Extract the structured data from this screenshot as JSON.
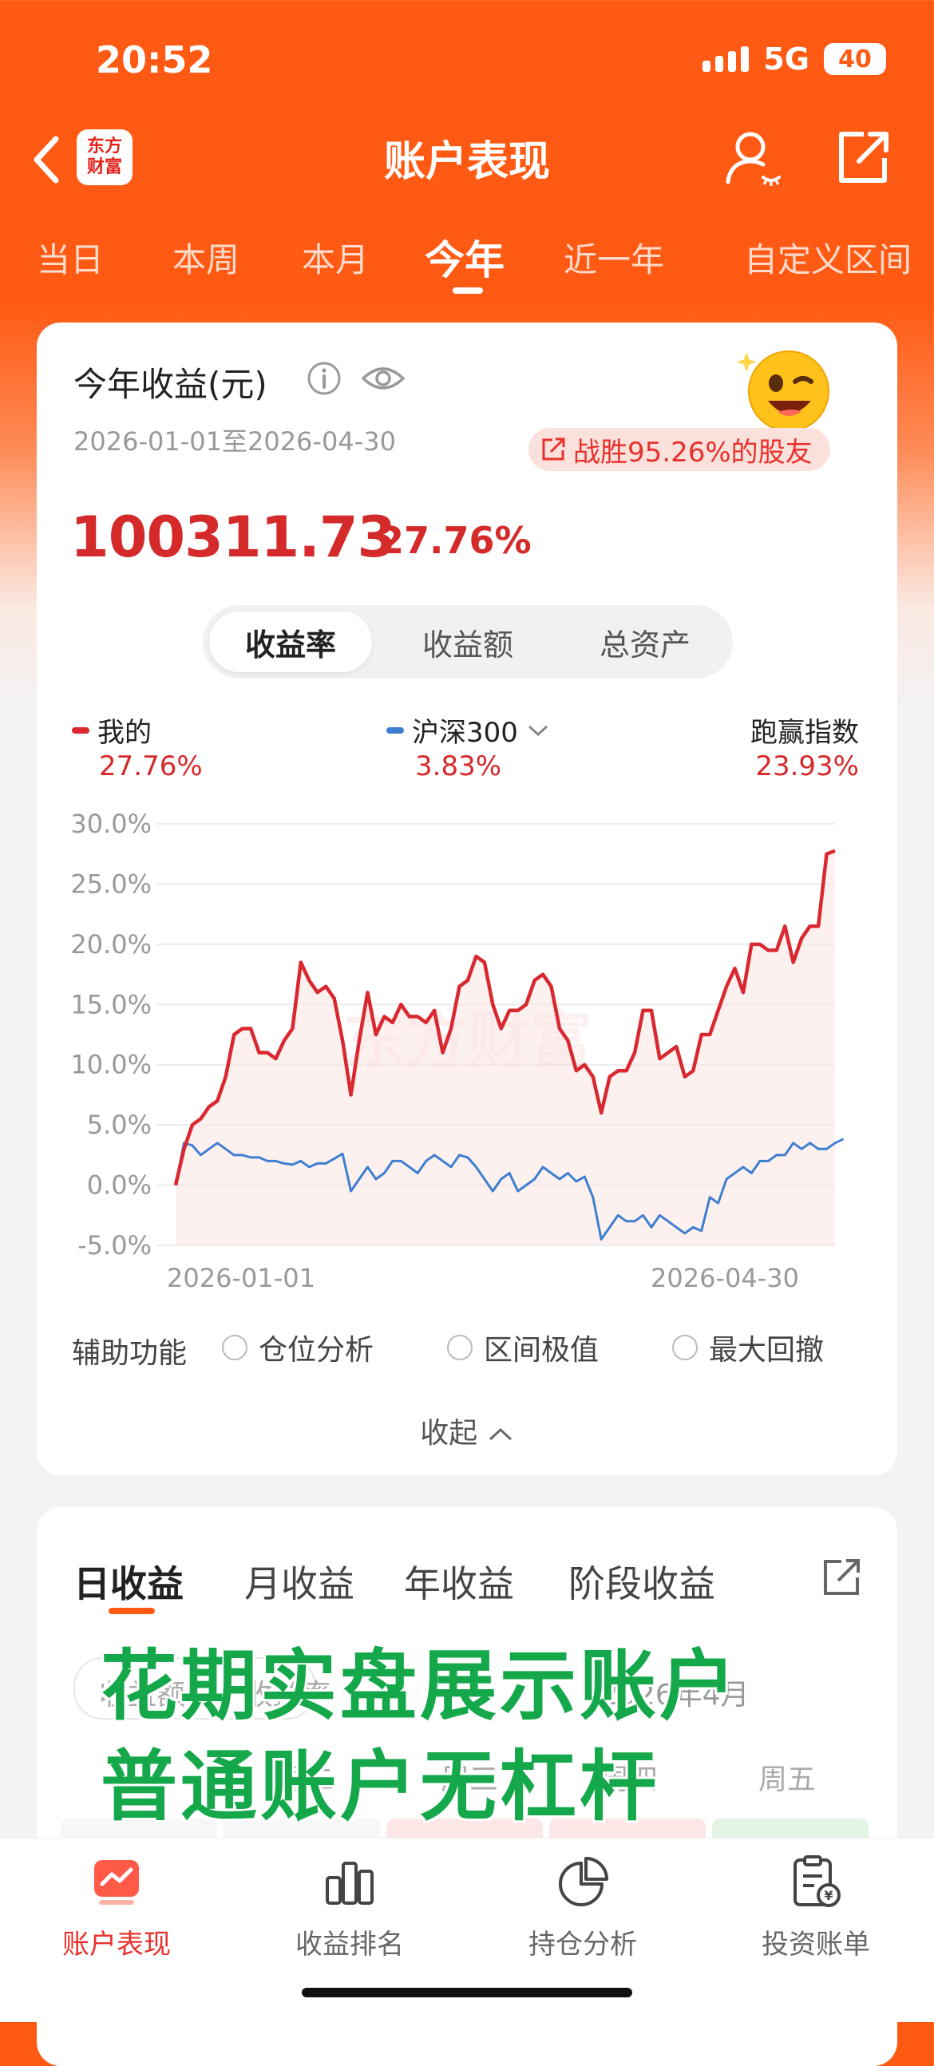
{
  "status_bar": {
    "time": "20:52",
    "network": "5G",
    "battery": "40"
  },
  "header": {
    "logo_line1": "东方",
    "logo_line2": "财富",
    "title": "账户表现"
  },
  "period_tabs": [
    {
      "label": "当日",
      "active": false
    },
    {
      "label": "本周",
      "active": false
    },
    {
      "label": "本月",
      "active": false
    },
    {
      "label": "今年",
      "active": true
    },
    {
      "label": "近一年",
      "active": false
    },
    {
      "label": "自定义区间",
      "active": false
    }
  ],
  "summary": {
    "title": "今年收益(元)",
    "date_range": "2026-01-01至2026-04-30",
    "beat_text": "战胜95.26%的股友",
    "profit_amount": "100311.73",
    "profit_rate": "27.76%"
  },
  "segmented": {
    "options": [
      "收益率",
      "收益额",
      "总资产"
    ],
    "selected": "收益率"
  },
  "legend": {
    "mine": {
      "label": "我的",
      "value": "27.76%",
      "color": "#d9282f"
    },
    "index": {
      "label": "沪深300",
      "value": "3.83%",
      "color": "#3f7fd0"
    },
    "outperform": {
      "label": "跑赢指数",
      "value": "23.93%"
    }
  },
  "chart_data": {
    "type": "line",
    "watermark": "东方财富",
    "x_start_label": "2026-01-01",
    "x_end_label": "2026-04-30",
    "y_ticks": [
      "30.0%",
      "25.0%",
      "20.0%",
      "15.0%",
      "10.0%",
      "5.0%",
      "0.0%",
      "-5.0%"
    ],
    "ylim": [
      -5,
      30
    ],
    "series": [
      {
        "name": "我的",
        "color": "#d9282f",
        "values": [
          0,
          3,
          5,
          5.5,
          6.5,
          7,
          9,
          12.5,
          13,
          13,
          11,
          11,
          10.5,
          12,
          13,
          18.5,
          17,
          16,
          16.5,
          15.5,
          12,
          7.5,
          12,
          16,
          12.5,
          14,
          13.5,
          15,
          14,
          14,
          13.5,
          14.5,
          11,
          13,
          16.5,
          17,
          19,
          18.5,
          15,
          13,
          14.5,
          14.5,
          15,
          17,
          17.5,
          16.5,
          13,
          12,
          9.5,
          10,
          9,
          6,
          9,
          9.5,
          9.5,
          11,
          14.5,
          14.5,
          10.5,
          11,
          11.5,
          9,
          9.5,
          12.5,
          12.5,
          14.5,
          16.5,
          18,
          16,
          20,
          20,
          19.5,
          19.5,
          21.5,
          18.5,
          20.5,
          21.5,
          21.5,
          27.5,
          27.76
        ]
      },
      {
        "name": "沪深300",
        "color": "#3f7fd0",
        "values": [
          0,
          3.5,
          3.3,
          2.5,
          3,
          3.5,
          3,
          2.5,
          2.5,
          2.3,
          2.3,
          2,
          2,
          1.8,
          1.7,
          2,
          1.5,
          1.8,
          1.8,
          2.2,
          2.6,
          -0.5,
          0.5,
          1.5,
          0.5,
          1,
          2,
          2,
          1.5,
          1,
          2,
          2.5,
          2,
          1.5,
          2.5,
          2.3,
          1.5,
          0.5,
          -0.5,
          0.5,
          1,
          -0.5,
          0,
          0.5,
          1.5,
          1,
          0.5,
          1,
          0.3,
          0.7,
          -1,
          -4.5,
          -3.5,
          -2.5,
          -3,
          -3,
          -2.5,
          -3.5,
          -2.5,
          -3,
          -3.5,
          -4,
          -3.5,
          -3.8,
          -1,
          -1.5,
          0.5,
          1,
          1.5,
          1,
          2,
          2,
          2.5,
          2.5,
          3.5,
          3,
          3.5,
          3,
          3,
          3.5,
          3.83
        ]
      }
    ]
  },
  "aux": {
    "label": "辅助功能",
    "options": [
      "仓位分析",
      "区间极值",
      "最大回撤"
    ],
    "collapse": "收起"
  },
  "daily": {
    "tabs": [
      "日收益",
      "月收益",
      "年收益",
      "阶段收益"
    ],
    "selected": "日收益",
    "toggle_left": "收益额",
    "toggle_right": "收益率",
    "month": "2026年4月",
    "weekdays": [
      "周二",
      "周三",
      "周四",
      "周五"
    ],
    "overlay_line1": "花期实盘展示账户",
    "overlay_line2": "普通账户无杠杆"
  },
  "bottom_nav": [
    {
      "label": "账户表现",
      "icon": "account-performance-icon",
      "active": true
    },
    {
      "label": "收益排名",
      "icon": "ranking-chart-icon",
      "active": false
    },
    {
      "label": "持仓分析",
      "icon": "pie-chart-icon",
      "active": false
    },
    {
      "label": "投资账单",
      "icon": "bill-icon",
      "active": false
    }
  ]
}
